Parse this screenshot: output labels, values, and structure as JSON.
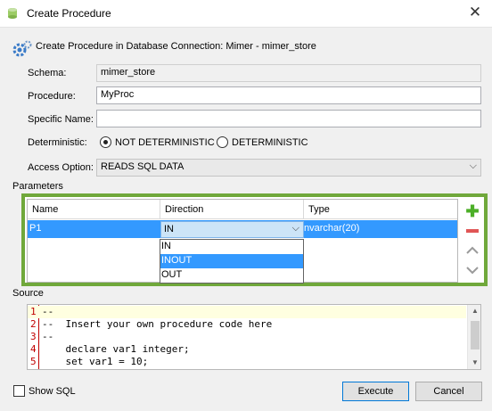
{
  "window": {
    "title": "Create Procedure",
    "close_glyph": "✕"
  },
  "header": {
    "text": "Create Procedure in Database Connection: Mimer - mimer_store"
  },
  "form": {
    "schema_label": "Schema:",
    "schema_value": "mimer_store",
    "procedure_label": "Procedure:",
    "procedure_value": "MyProc",
    "specific_name_label": "Specific Name:",
    "specific_name_value": "",
    "deterministic_label": "Deterministic:",
    "deterministic_options": [
      "NOT DETERMINISTIC",
      "DETERMINISTIC"
    ],
    "deterministic_selected": "NOT DETERMINISTIC",
    "access_label": "Access Option:",
    "access_value": "READS SQL DATA"
  },
  "parameters": {
    "section_label": "Parameters",
    "columns": [
      "Name",
      "Direction",
      "Type"
    ],
    "rows": [
      {
        "name": "P1",
        "direction": "IN",
        "type": "nvarchar(20)"
      }
    ],
    "direction_options": [
      "IN",
      "INOUT",
      "OUT"
    ],
    "direction_highlighted": "INOUT",
    "accent_color": "#70a83b",
    "selection_color": "#3399ff",
    "side_buttons": [
      "add-icon",
      "remove-icon",
      "move-up-icon",
      "move-down-icon"
    ]
  },
  "source": {
    "section_label": "Source",
    "lines": [
      {
        "n": "1",
        "text": "--"
      },
      {
        "n": "2",
        "text": "--  Insert your own procedure code here"
      },
      {
        "n": "3",
        "text": "--"
      },
      {
        "n": "4",
        "text": "    declare var1 integer;"
      },
      {
        "n": "5",
        "text": "    set var1 = 10;"
      }
    ]
  },
  "footer": {
    "show_sql_label": "Show SQL",
    "execute_label": "Execute",
    "cancel_label": "Cancel"
  }
}
